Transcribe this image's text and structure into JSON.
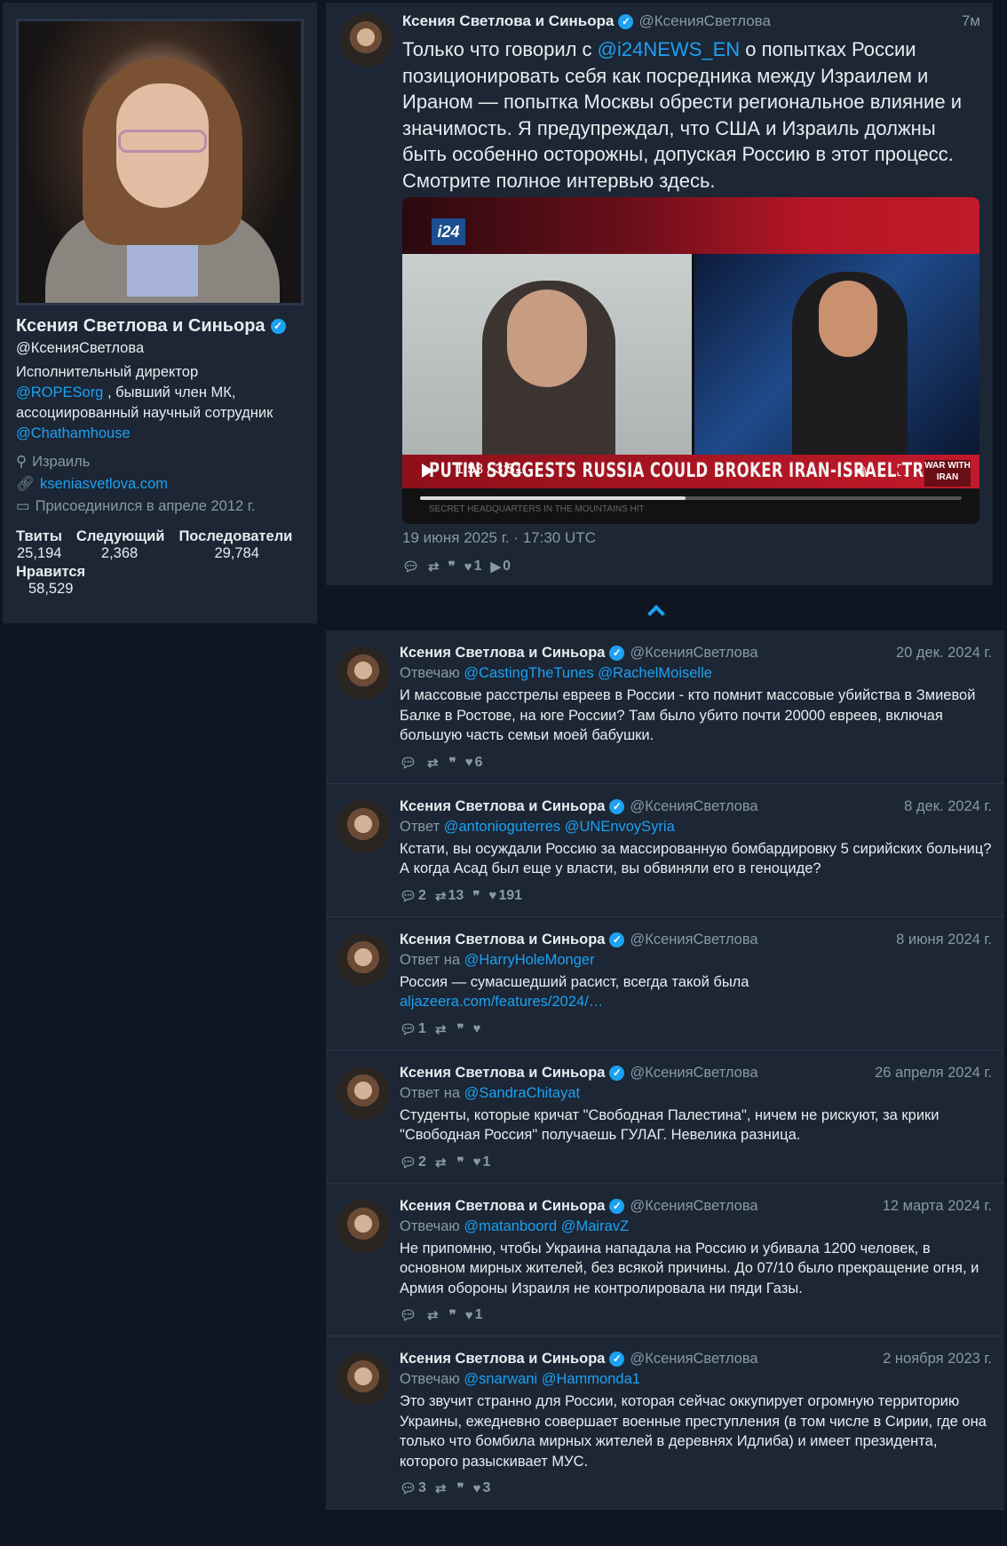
{
  "profile": {
    "name": "Ксения Светлова и Синьора",
    "handle": "@КсенияСветлова",
    "bio_line1": "Исполнительный директор",
    "bio_link1": "@ROPESorg",
    "bio_line2": " , бывший член МК, ассоциированный научный сотрудник",
    "bio_link2": "@Chathamhouse",
    "location": "Израиль",
    "website": "kseniasvetlova.com",
    "joined": "Присоединился в апреле 2012 г.",
    "stats": {
      "tweets_label": "Твиты",
      "tweets": "25,194",
      "following_label": "Следующий",
      "following": "2,368",
      "followers_label": "Последователи",
      "followers": "29,784",
      "likes_label": "Нравится",
      "likes": "58,529"
    }
  },
  "main_tweet": {
    "name": "Ксения Светлова и Синьора",
    "handle": "@КсенияСветлова",
    "time": "7м",
    "text_before": "Только что говорил с ",
    "mention": "@i24NEWS_EN",
    "text_after": " о попытках России позиционировать себя как посредника между Израилем и Ираном — попытка Москвы обрести региональное влияние и значимость. Я предупреждал, что США и Израиль должны быть особенно осторожны, допуская Россию в этот процесс. Смотрите полное интервью здесь.",
    "video": {
      "logo": "i24",
      "headline": "PUTIN SUGGESTS RUSSIA COULD BROKER IRAN-ISRAEL TRUCE",
      "time": "1:53 / 3:51",
      "progress": 0.49,
      "badge": "WAR WITH IRAN",
      "ticker": "SECRET HEADQUARTERS IN THE MOUNTAINS HIT"
    },
    "date": "19 июня 2025 г. · 17:30 UTC",
    "likes": "1",
    "views": "0"
  },
  "tweets": [
    {
      "name": "Ксения Светлова и Синьора",
      "handle": "@КсенияСветлова",
      "time": "20 дек. 2024 г.",
      "reply_prefix": "Отвечаю ",
      "reply_to": "@CastingTheTunes @RachelMoiselle",
      "text": "И массовые расстрелы евреев в России - кто помнит массовые убийства в Змиевой Балке в Ростове, на юге России? Там было убито почти 20000 евреев, включая большую часть семьи моей бабушки.",
      "link": "",
      "replies": "",
      "retweets": "",
      "likes": "6"
    },
    {
      "name": "Ксения Светлова и Синьора",
      "handle": "@КсенияСветлова",
      "time": "8 дек. 2024 г.",
      "reply_prefix": "Ответ ",
      "reply_to": "@antonioguterres @UNEnvoySyria",
      "text": "Кстати, вы осуждали Россию за массированную бомбардировку 5 сирийских больниц? А когда Асад был еще у власти, вы обвиняли его в геноциде?",
      "link": "",
      "replies": "2",
      "retweets": "13",
      "likes": "191"
    },
    {
      "name": "Ксения Светлова и Синьора",
      "handle": "@КсенияСветлова",
      "time": "8 июня 2024 г.",
      "reply_prefix": "Ответ на ",
      "reply_to": "@HarryHoleMonger",
      "text": "Россия — сумасшедший расист, всегда такой была",
      "link": "aljazeera.com/features/2024/…",
      "replies": "1",
      "retweets": "",
      "likes": ""
    },
    {
      "name": "Ксения Светлова и Синьора",
      "handle": "@КсенияСветлова",
      "time": "26 апреля 2024 г.",
      "reply_prefix": "Ответ на ",
      "reply_to": "@SandraChitayat",
      "text": "Студенты, которые кричат \"Свободная Палестина\", ничем не рискуют, за крики \"Свободная Россия\" получаешь ГУЛАГ. Невелика разница.",
      "link": "",
      "replies": "2",
      "retweets": "",
      "likes": "1"
    },
    {
      "name": "Ксения Светлова и Синьора",
      "handle": "@КсенияСветлова",
      "time": "12 марта 2024 г.",
      "reply_prefix": "Отвечаю ",
      "reply_to": "@matanboord @MairavZ",
      "text": "Не припомню, чтобы Украина нападала на Россию и убивала 1200 человек, в основном мирных жителей, без всякой причины. До 07/10 было прекращение огня, и Армия обороны Израиля не контролировала ни пяди Газы.",
      "link": "",
      "replies": "",
      "retweets": "",
      "likes": "1"
    },
    {
      "name": "Ксения Светлова и Синьора",
      "handle": "@КсенияСветлова",
      "time": "2 ноября 2023 г.",
      "reply_prefix": "Отвечаю ",
      "reply_to": "@snarwani @Hammonda1",
      "text": "Это звучит странно для России, которая сейчас оккупирует огромную территорию Украины, ежедневно совершает военные преступления (в том числе в Сирии, где она только что бомбила мирных жителей в деревнях Идлиба) и имеет президента, которого разыскивает МУС.",
      "link": "",
      "replies": "3",
      "retweets": "",
      "likes": "3"
    }
  ],
  "colors": {
    "accent": "#1da1f2",
    "card": "#1c2634",
    "background": "#101621",
    "muted": "#8899a6"
  },
  "icons": [
    "verified-icon",
    "location-icon",
    "link-icon",
    "calendar-icon",
    "reply-icon",
    "retweet-icon",
    "quote-icon",
    "like-icon",
    "views-icon",
    "play-icon",
    "volume-icon",
    "fullscreen-icon"
  ]
}
